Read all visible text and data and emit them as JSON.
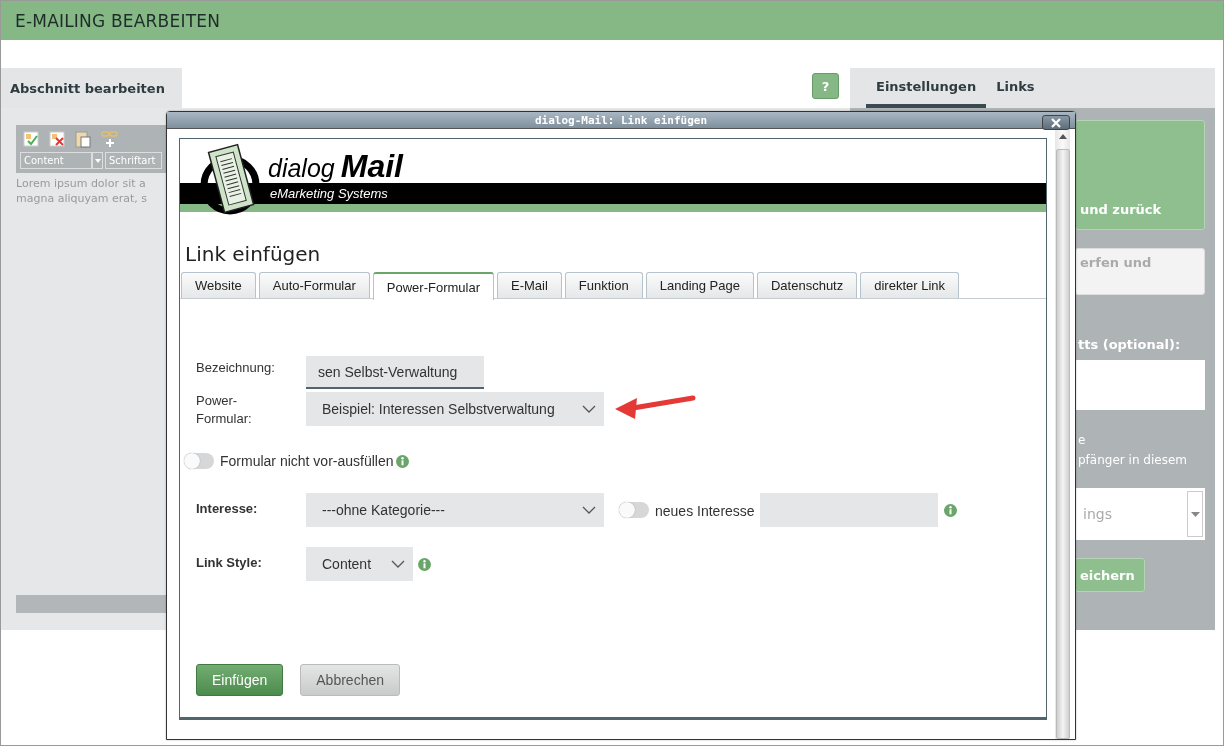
{
  "header": {
    "title": "E-MAILING BEARBEITEN"
  },
  "left_panel": {
    "tab": "Abschnitt bearbeiten",
    "help": "?",
    "editor": {
      "selects": [
        "Content",
        "Schriftart"
      ],
      "lines": [
        "Lorem ipsum dolor sit a",
        "magna aliquyam erat, s"
      ]
    }
  },
  "right_panel": {
    "tabs": [
      {
        "label": "Einstellungen",
        "selected": true
      },
      {
        "label": "Links",
        "selected": false
      }
    ],
    "items": [
      {
        "kind": "primary",
        "text": "und zurück"
      },
      {
        "kind": "secondary",
        "text": "erfen und"
      },
      {
        "kind": "label",
        "text": "tts (optional):"
      },
      {
        "kind": "input"
      },
      {
        "kind": "text",
        "text": "e"
      },
      {
        "kind": "text",
        "text": "pfänger in diesem"
      },
      {
        "kind": "select",
        "text": "ings"
      },
      {
        "kind": "save",
        "text": "eichern"
      }
    ]
  },
  "dialog": {
    "title": "dialog-Mail: Link einfügen",
    "logo": {
      "word_1": "dialog",
      "word_2": "Mail",
      "tagline": "eMarketing Systems"
    },
    "heading": "Link einfügen",
    "tabs": [
      {
        "label": "Website",
        "selected": false
      },
      {
        "label": "Auto-Formular",
        "selected": false
      },
      {
        "label": "Power-Formular",
        "selected": true
      },
      {
        "label": "E-Mail",
        "selected": false
      },
      {
        "label": "Funktion",
        "selected": false
      },
      {
        "label": "Landing Page",
        "selected": false
      },
      {
        "label": "Datenschutz",
        "selected": false
      },
      {
        "label": "direkter Link",
        "selected": false
      }
    ],
    "bezeichnung": {
      "label": "Bezeichnung:",
      "value": "sen Selbst-Verwaltung"
    },
    "power_formular": {
      "label_1": "Power-",
      "label_2": "Formular:",
      "value": "Beispiel: Interessen Selbstverwaltung"
    },
    "prefill_toggle": {
      "label": "Formular nicht vor-ausfüllen",
      "on": false
    },
    "interesse": {
      "label": "Interesse:",
      "value": "---ohne Kategorie---",
      "new_toggle": {
        "label": "neues Interesse",
        "on": false
      }
    },
    "link_style": {
      "label": "Link Style:",
      "value": "Content"
    },
    "buttons": [
      {
        "kind": "primary",
        "label": "Einfügen"
      },
      {
        "kind": "secondary",
        "label": "Abbrechen"
      }
    ]
  }
}
